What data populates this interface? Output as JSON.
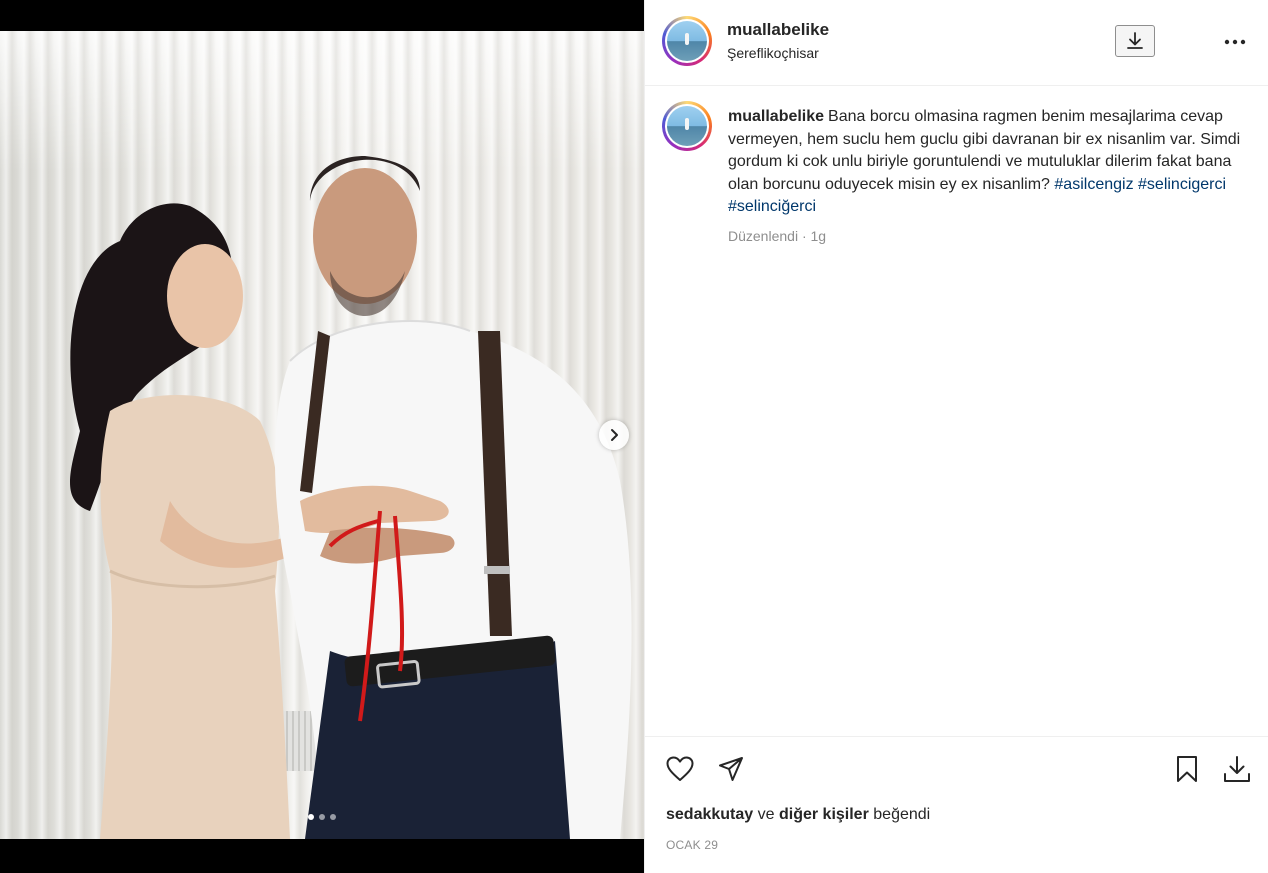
{
  "post": {
    "username": "muallabelike",
    "location": "Şereflikoçhisar",
    "caption": "Bana borcu olmasina ragmen benim mesajlarima cevap vermeyen, hem suclu hem guclu gibi davranan bir ex nisanlim var. Simdi gordum ki cok unlu biriyle goruntulendi ve mutuluklar dilerim fakat bana olan borcunu oduyecek misin ey ex nisanlim?",
    "hashtags": [
      "#asilcengiz",
      "#selincigerci",
      "#selinciğerci"
    ],
    "edited_label": "Düzenlendi",
    "time_ago": "1g",
    "meta_separator": "·",
    "liked_by_user": "sedakkutay",
    "liked_connector": "ve",
    "liked_others": "diğer kişiler",
    "liked_suffix": "beğendi",
    "date": "OCAK 29",
    "carousel": {
      "count": 3,
      "active": 0
    }
  },
  "icons": {
    "download": "download-icon",
    "more": "more-icon",
    "like": "heart-icon",
    "share": "send-icon",
    "save": "bookmark-icon",
    "save_download": "download-icon",
    "next": "chevron-right-icon"
  },
  "colors": {
    "text": "#262626",
    "secondary": "#8e8e8e",
    "hashtag": "#00376b",
    "border": "#efefef",
    "media_bg": "#000000"
  }
}
